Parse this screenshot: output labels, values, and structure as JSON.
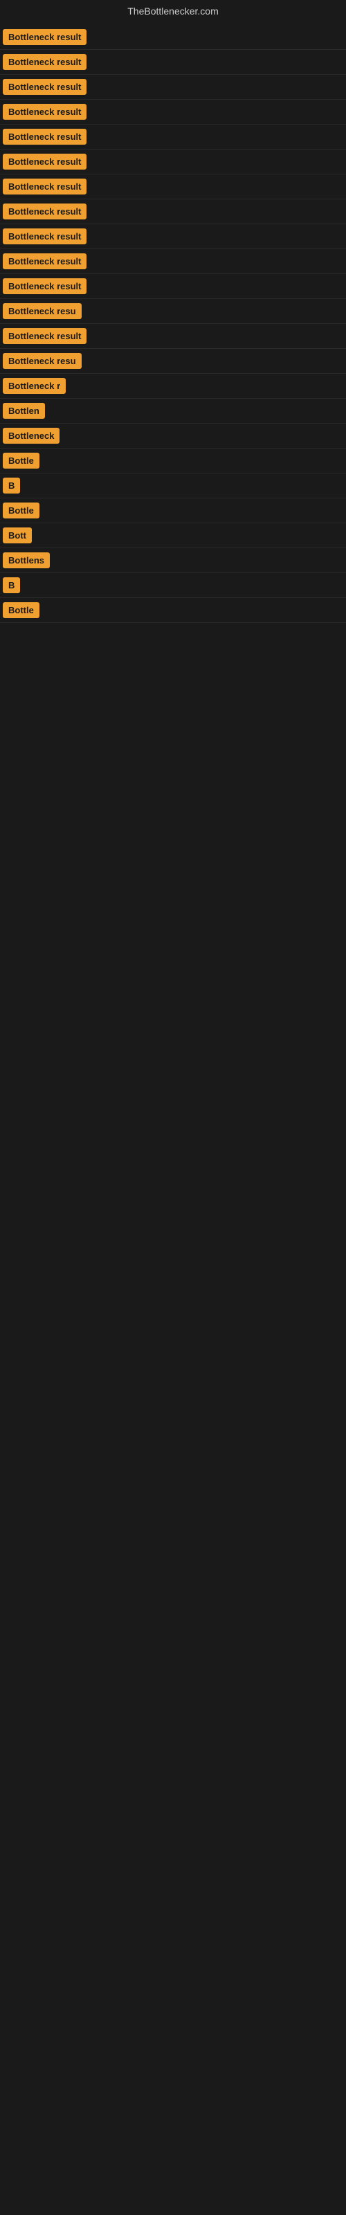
{
  "site_title": "TheBottlenecker.com",
  "rows": [
    {
      "id": 1,
      "label": "Bottleneck result",
      "truncated": false
    },
    {
      "id": 2,
      "label": "Bottleneck result",
      "truncated": false
    },
    {
      "id": 3,
      "label": "Bottleneck result",
      "truncated": false
    },
    {
      "id": 4,
      "label": "Bottleneck result",
      "truncated": false
    },
    {
      "id": 5,
      "label": "Bottleneck result",
      "truncated": false
    },
    {
      "id": 6,
      "label": "Bottleneck result",
      "truncated": false
    },
    {
      "id": 7,
      "label": "Bottleneck result",
      "truncated": false
    },
    {
      "id": 8,
      "label": "Bottleneck result",
      "truncated": false
    },
    {
      "id": 9,
      "label": "Bottleneck result",
      "truncated": false
    },
    {
      "id": 10,
      "label": "Bottleneck result",
      "truncated": false
    },
    {
      "id": 11,
      "label": "Bottleneck result",
      "truncated": false
    },
    {
      "id": 12,
      "label": "Bottleneck resu",
      "truncated": true
    },
    {
      "id": 13,
      "label": "Bottleneck result",
      "truncated": false
    },
    {
      "id": 14,
      "label": "Bottleneck resu",
      "truncated": true
    },
    {
      "id": 15,
      "label": "Bottleneck r",
      "truncated": true
    },
    {
      "id": 16,
      "label": "Bottlen",
      "truncated": true
    },
    {
      "id": 17,
      "label": "Bottleneck",
      "truncated": true
    },
    {
      "id": 18,
      "label": "Bottle",
      "truncated": true
    },
    {
      "id": 19,
      "label": "B",
      "truncated": true
    },
    {
      "id": 20,
      "label": "Bottle",
      "truncated": true
    },
    {
      "id": 21,
      "label": "Bott",
      "truncated": true
    },
    {
      "id": 22,
      "label": "Bottlens",
      "truncated": true
    },
    {
      "id": 23,
      "label": "B",
      "truncated": true
    },
    {
      "id": 24,
      "label": "Bottle",
      "truncated": true
    }
  ]
}
